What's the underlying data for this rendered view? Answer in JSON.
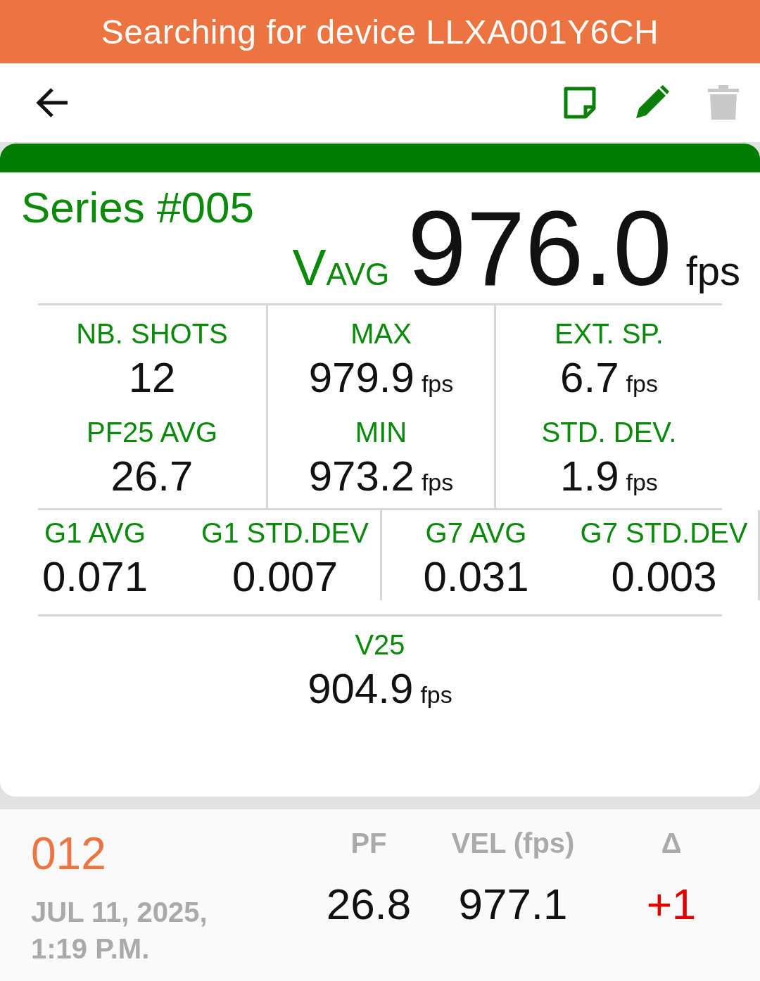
{
  "banner": {
    "text": "Searching for device LLXA001Y6CH"
  },
  "toolbar": {
    "actions": [
      {
        "kind": "note",
        "disabled": false
      },
      {
        "kind": "edit",
        "disabled": false
      },
      {
        "kind": "delete",
        "disabled": true
      }
    ]
  },
  "series": {
    "title": "Series #005",
    "velocity": {
      "label": "V",
      "label_sub": "AVG",
      "value": "976.0",
      "unit": "fps"
    },
    "stats": [
      {
        "label": "NB. SHOTS",
        "value": "12"
      },
      {
        "label": "PF25 AVG",
        "value": "26.7"
      },
      {
        "label": "MAX",
        "value": "979.9",
        "unit": "fps"
      },
      {
        "label": "MIN",
        "value": "973.2",
        "unit": "fps"
      },
      {
        "label": "EXT. SP.",
        "value": "6.7",
        "unit": "fps"
      },
      {
        "label": "STD. DEV.",
        "value": "1.9",
        "unit": "fps"
      }
    ],
    "groups": [
      {
        "label": "G1 AVG",
        "value": "0.071"
      },
      {
        "label": "G1 STD.DEV",
        "value": "0.007"
      },
      {
        "label": "G7 AVG",
        "value": "0.031"
      },
      {
        "label": "G7 STD.DEV",
        "value": "0.003"
      }
    ],
    "v25": {
      "label": "V25",
      "value": "904.9",
      "unit": "fps"
    }
  },
  "shot": {
    "number": "012",
    "date": "JUL 11, 2025, 1:19 P.M.",
    "columns": [
      "PF",
      "VEL (fps)",
      "Δ"
    ],
    "values": [
      "26.8",
      "977.1",
      "+1"
    ]
  }
}
